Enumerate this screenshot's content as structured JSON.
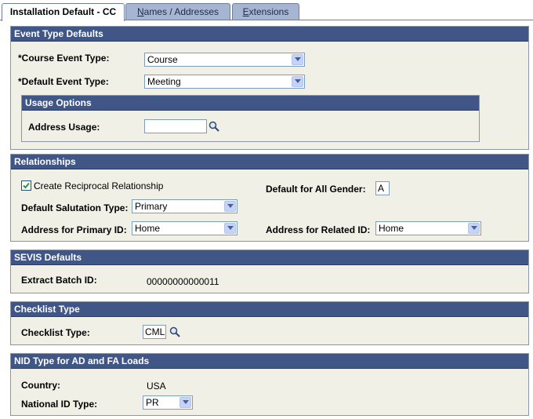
{
  "tabs": [
    {
      "label": "Installation Default - CC"
    },
    {
      "label_first": "N",
      "label_rest": "ames / Addresses"
    },
    {
      "label_first": "E",
      "label_rest": "xtensions"
    }
  ],
  "event_type_defaults": {
    "title": "Event Type Defaults",
    "course_event_type_label": "*Course Event Type:",
    "course_event_type_value": "Course",
    "default_event_type_label": "*Default Event Type:",
    "default_event_type_value": "Meeting",
    "usage_options": {
      "title": "Usage Options",
      "address_usage_label": "Address Usage:",
      "address_usage_value": ""
    }
  },
  "relationships": {
    "title": "Relationships",
    "reciprocal_label": "Create Reciprocal Relationship",
    "reciprocal_checked": true,
    "default_gender_label": "Default for All Gender:",
    "default_gender_value": "A",
    "salutation_label": "Default Salutation Type:",
    "salutation_value": "Primary",
    "address_primary_label": "Address for Primary ID:",
    "address_primary_value": "Home",
    "address_related_label": "Address for Related ID:",
    "address_related_value": "Home"
  },
  "sevis_defaults": {
    "title": "SEVIS Defaults",
    "extract_batch_label": "Extract Batch ID:",
    "extract_batch_value": "00000000000011"
  },
  "checklist_type": {
    "title": "Checklist Type",
    "checklist_label": "Checklist Type:",
    "checklist_value": "CML"
  },
  "nid_type": {
    "title": "NID Type for AD and FA Loads",
    "country_label": "Country:",
    "country_value": "USA",
    "national_id_label": "National ID Type:",
    "national_id_value": "PR"
  },
  "colors": {
    "header_bg": "#3f5687",
    "box_bg": "#f0f0e6",
    "tab_inactive": "#a6b6d2"
  }
}
